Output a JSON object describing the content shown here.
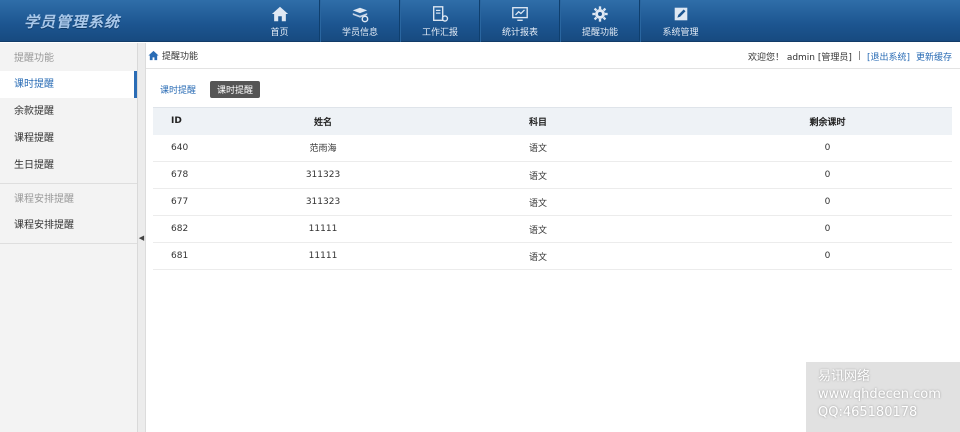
{
  "app": {
    "title": "学员管理系统"
  },
  "nav": [
    {
      "label": "首页",
      "icon": "home-icon"
    },
    {
      "label": "学员信息",
      "icon": "books-icon"
    },
    {
      "label": "工作汇报",
      "icon": "report-icon"
    },
    {
      "label": "统计报表",
      "icon": "monitor-icon"
    },
    {
      "label": "提醒功能",
      "icon": "gear-icon"
    },
    {
      "label": "系统管理",
      "icon": "edit-icon"
    }
  ],
  "sidebar": {
    "groups": [
      {
        "title": "提醒功能",
        "items": [
          "课时提醒",
          "余款提醒",
          "课程提醒",
          "生日提醒"
        ]
      },
      {
        "title": "课程安排提醒",
        "items": [
          "课程安排提醒"
        ]
      }
    ],
    "active": "课时提醒"
  },
  "breadcrumb": {
    "text": "提醒功能"
  },
  "user": {
    "welcome": "欢迎您！ admin [管理员]",
    "separator": "|",
    "logout": "[退出系统]",
    "refresh": "更新缓存"
  },
  "tabs": {
    "link": "课时提醒",
    "button": "课时提醒"
  },
  "table": {
    "headers": [
      "ID",
      "姓名",
      "科目",
      "剩余课时"
    ],
    "rows": [
      [
        "640",
        "范雨海",
        "语文",
        "0"
      ],
      [
        "678",
        "311323",
        "语文",
        "0"
      ],
      [
        "677",
        "311323",
        "语文",
        "0"
      ],
      [
        "682",
        "11111",
        "语文",
        "0"
      ],
      [
        "681",
        "11111",
        "语文",
        "0"
      ]
    ]
  },
  "watermark": {
    "line1": "易讯网络",
    "line2": "www.qhdecen.com",
    "line3": "QQ:465180178"
  },
  "colors": {
    "topbar": "#1c5590",
    "accent": "#2a6cb5",
    "tab_button": "#555555"
  }
}
